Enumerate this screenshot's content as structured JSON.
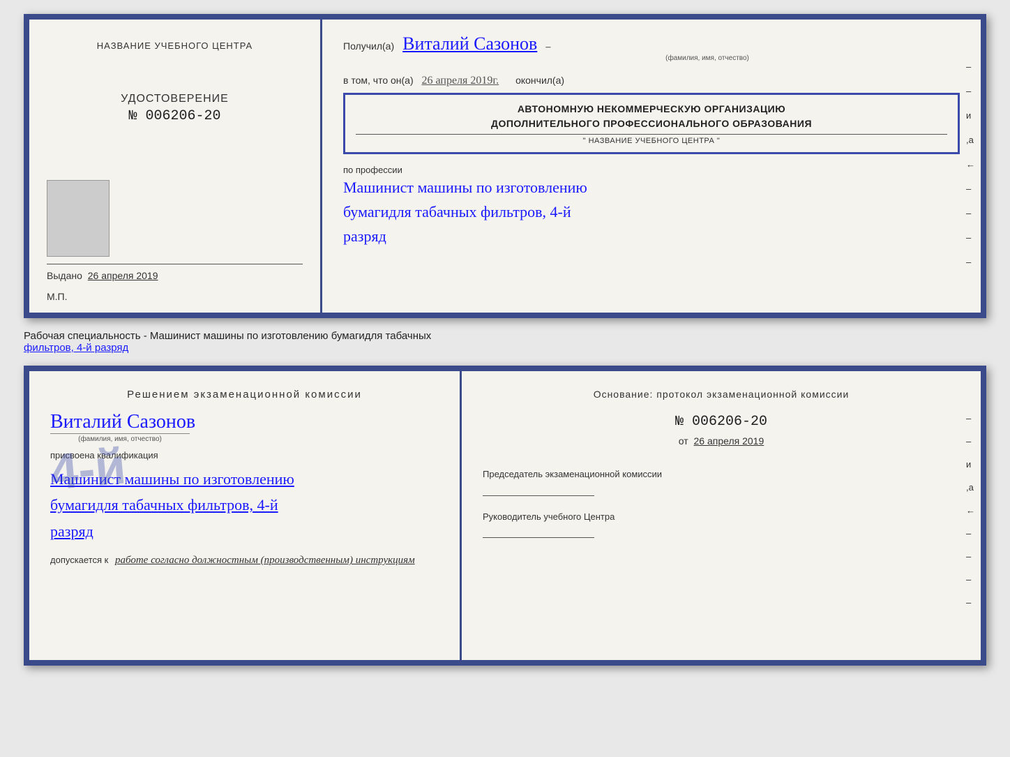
{
  "background_color": "#e8e8e8",
  "border_color": "#3a4a8a",
  "top_cert": {
    "left": {
      "training_center_label": "НАЗВАНИЕ УЧЕБНОГО ЦЕНТРА",
      "udostoverenie_title": "УДОСТОВЕРЕНИЕ",
      "udostoverenie_number": "№ 006206-20",
      "vydano_label": "Выдано",
      "vydano_date": "26 апреля 2019",
      "mp_label": "М.П."
    },
    "right": {
      "poluchil_prefix": "Получил(а)",
      "recipient_name": "Виталий Сазонов",
      "fio_label": "(фамилия, имя, отчество)",
      "dash": "–",
      "vtom_prefix": "в том, что он(а)",
      "date_handwritten": "26 апреля 2019г.",
      "okoncil_label": "окончил(а)",
      "stamp_line1": "АВТОНОМНУЮ НЕКОММЕРЧЕСКУЮ ОРГАНИЗАЦИЮ",
      "stamp_line2": "ДОПОЛНИТЕЛЬНОГО ПРОФЕССИОНАЛЬНОГО ОБРАЗОВАНИЯ",
      "stamp_line3": "\" НАЗВАНИЕ УЧЕБНОГО ЦЕНТРА \"",
      "po_professii": "по профессии",
      "profession_line1": "Машинист машины по изготовлению",
      "profession_line2": "бумагидля табачных фильтров, 4-й",
      "profession_line3": "разряд",
      "side_marks": [
        "–",
        "–",
        "и",
        ",а",
        "←",
        "–",
        "–",
        "–",
        "–"
      ]
    }
  },
  "specialty_text": {
    "prefix": "Рабочая специальность - Машинист машины по изготовлению бумагидля табачных",
    "underline_part": "фильтров, 4-й разряд"
  },
  "bottom_cert": {
    "left": {
      "resheniem_title": "Решением  экзаменационной  комиссии",
      "person_name": "Виталий Сазонов",
      "fio_label": "(фамилия, имя, отчество)",
      "prisvoena_label": "присвоена квалификация",
      "qual_line1": "Машинист машины по изготовлению",
      "qual_line2": "бумагидля табачных фильтров, 4-й",
      "qual_line3": "разряд",
      "dopuskaetsya_prefix": "допускается к",
      "dopuskaetsya_text": "работе согласно должностным (производственным) инструкциям"
    },
    "right": {
      "osnovanie_label": "Основание: протокол экзаменационной  комиссии",
      "protocol_number": "№  006206-20",
      "ot_prefix": "от",
      "ot_date": "26 апреля 2019",
      "predsedatel_title": "Председатель экзаменационной комиссии",
      "rukovoditel_title": "Руководитель учебного Центра",
      "side_marks": [
        "–",
        "–",
        "и",
        ",а",
        "←",
        "–",
        "–",
        "–",
        "–"
      ]
    }
  },
  "big_stamp_number": "4-й"
}
